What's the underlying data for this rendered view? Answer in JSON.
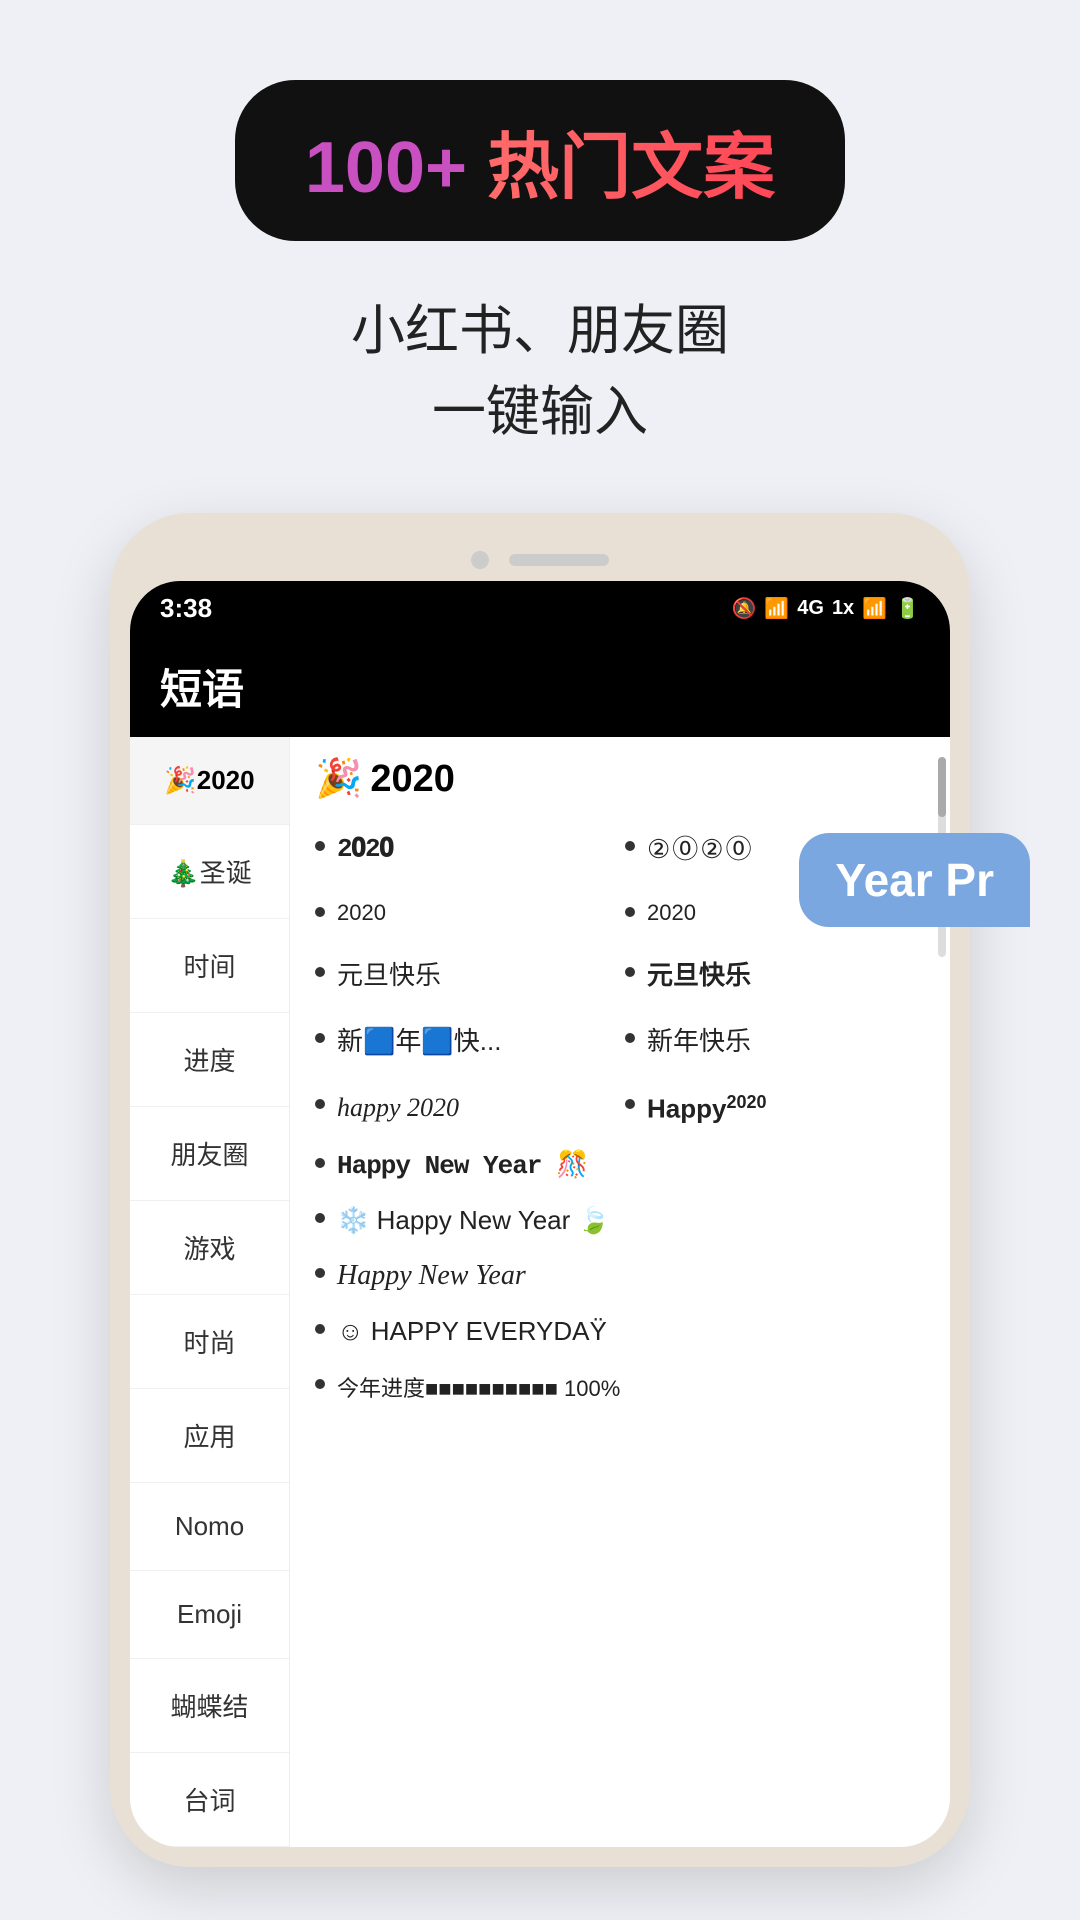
{
  "badge": {
    "number": "100+",
    "text": "热门文案"
  },
  "subtitle": {
    "line1": "小红书、朋友圈",
    "line2": "一键输入"
  },
  "phone": {
    "status_bar": {
      "time": "3:38",
      "icons": "🔕 📶 4G 1x 📶 🔋"
    },
    "app_title": "短语",
    "sidebar_items": [
      {
        "label": "🎉2020",
        "active": true
      },
      {
        "label": "🎄圣诞",
        "active": false
      },
      {
        "label": "时间",
        "active": false
      },
      {
        "label": "进度",
        "active": false
      },
      {
        "label": "朋友圈",
        "active": false
      },
      {
        "label": "游戏",
        "active": false
      },
      {
        "label": "时尚",
        "active": false
      },
      {
        "label": "应用",
        "active": false
      },
      {
        "label": "Nomo",
        "active": false
      },
      {
        "label": "Emoji",
        "active": false
      },
      {
        "label": "蝴蝶结",
        "active": false
      },
      {
        "label": "台词",
        "active": false
      }
    ],
    "content": {
      "title": "🎉 2020",
      "items": [
        {
          "text": "2𝟎2𝟎",
          "style": "normal",
          "full": false
        },
        {
          "text": "②⓪②⓪",
          "style": "circled",
          "full": false
        },
        {
          "text": "2020",
          "style": "normal-small",
          "full": false
        },
        {
          "text": "2020",
          "style": "normal-small",
          "full": false
        },
        {
          "text": "元旦快乐",
          "style": "normal",
          "full": false
        },
        {
          "text": "元旦快乐",
          "style": "bold",
          "full": false
        },
        {
          "text": "新🟦年🟦快...",
          "style": "normal",
          "full": false
        },
        {
          "text": "新年快乐",
          "style": "normal",
          "full": false
        },
        {
          "text": "happy 2020",
          "style": "italic",
          "full": false
        },
        {
          "text": "Happy²⁰²⁰",
          "style": "bold",
          "full": false
        },
        {
          "text": "Happy New Year 🎊",
          "style": "special",
          "full": true
        },
        {
          "text": "❄️ Happy New Year 🍃",
          "style": "normal",
          "full": true
        },
        {
          "text": "Happy New Year",
          "style": "cursive",
          "full": true
        },
        {
          "text": "☺ HAPPY EVERYDAŸ",
          "style": "normal",
          "full": true
        },
        {
          "text": "今年进度■■■■■■■■■■ 100%",
          "style": "progress",
          "full": true
        }
      ]
    },
    "tooltip": "Year Pr"
  }
}
